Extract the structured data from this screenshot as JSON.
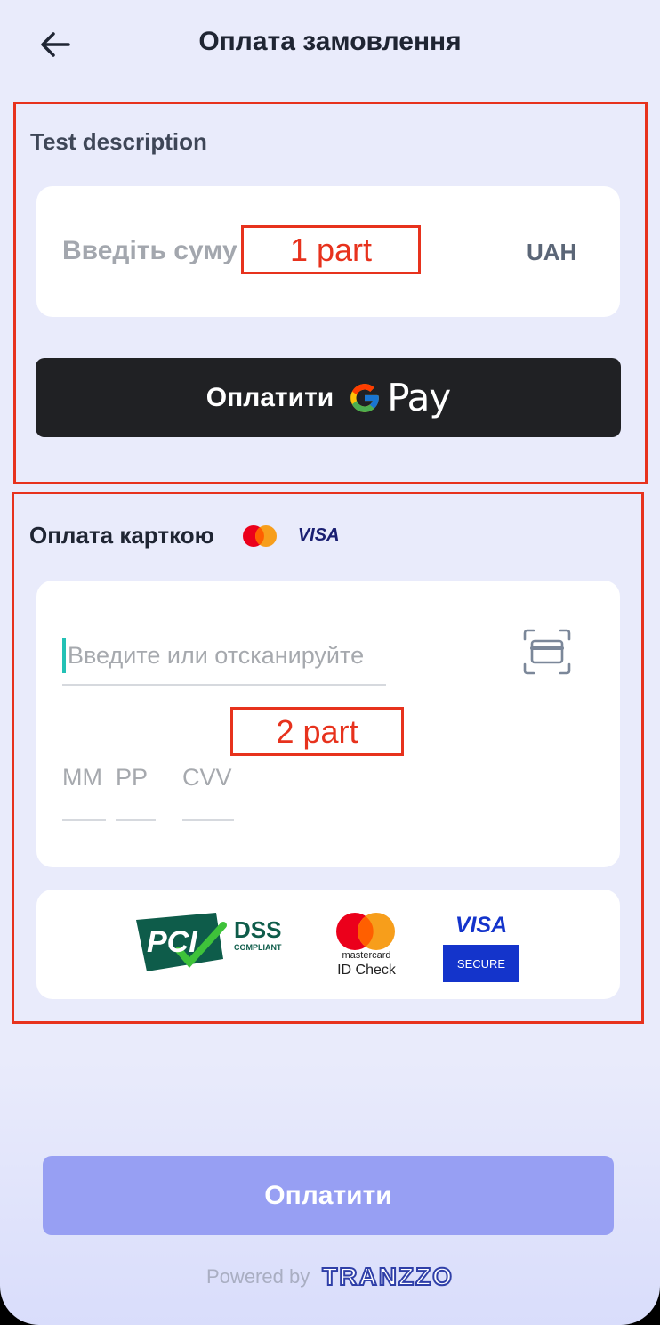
{
  "header": {
    "title": "Оплата замовлення"
  },
  "annotations": {
    "part1": "1 part",
    "part2": "2 part"
  },
  "amount_section": {
    "description": "Test description",
    "amount_placeholder": "Введіть суму",
    "currency": "UAH",
    "gpay_label": "Оплатити",
    "gpay_brand": "Pay"
  },
  "card_section": {
    "title": "Оплата карткою",
    "brand_visa": "VISA",
    "card_number_placeholder": "Введите или отсканируйте",
    "month_placeholder": "ММ",
    "year_placeholder": "РР",
    "cvv_placeholder": "CVV"
  },
  "trust_badges": {
    "pci_text": "PCI",
    "dss": "DSS",
    "compliant": "COMPLIANT",
    "mastercard_name": "mastercard",
    "mastercard_idcheck": "ID Check",
    "visa": "VISA",
    "visa_secure": "SECURE"
  },
  "footer": {
    "pay_button": "Оплатити",
    "powered_by": "Powered by",
    "brand": "TRANZZO"
  },
  "colors": {
    "background": "#e9ebfb",
    "pay_button": "#979ff3",
    "gpay_button": "#202124",
    "annotation": "#e7321d",
    "cursor": "#23c1b5"
  }
}
